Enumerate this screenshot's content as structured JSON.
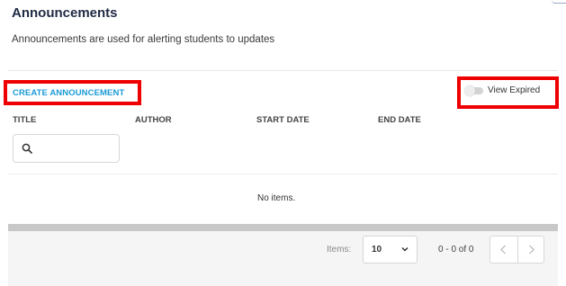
{
  "header": {
    "title": "Announcements",
    "subtitle": "Announcements are used for alerting students to updates"
  },
  "toolbar": {
    "create_label": "CREATE ANNOUNCEMENT",
    "view_expired_label": "View Expired",
    "view_expired_on": false
  },
  "table": {
    "columns": [
      "TITLE",
      "AUTHOR",
      "START DATE",
      "END DATE"
    ],
    "search_value": "",
    "empty_text": "No items."
  },
  "pagination": {
    "items_label": "Items:",
    "page_size": "10",
    "range": "0 - 0 of 0"
  },
  "icons": {
    "search": "search-icon",
    "dropdown": "chevron-down-icon",
    "prev": "chevron-left-icon",
    "next": "chevron-right-icon"
  },
  "colors": {
    "accent": "#1a9ad6",
    "highlight": "#ee0000",
    "title": "#1f2a44"
  }
}
